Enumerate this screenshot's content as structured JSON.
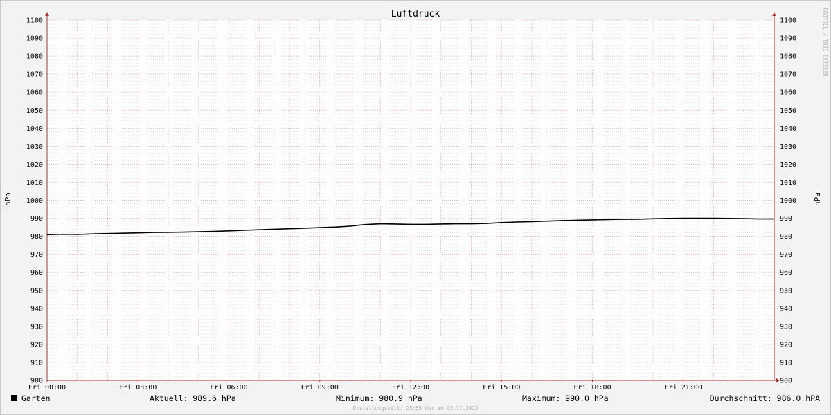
{
  "chart_data": {
    "type": "line",
    "title": "Luftdruck",
    "ylabel": "hPa",
    "ylim": [
      900,
      1100
    ],
    "y_ticks": [
      900,
      910,
      920,
      930,
      940,
      950,
      960,
      970,
      980,
      990,
      1000,
      1010,
      1020,
      1030,
      1040,
      1050,
      1060,
      1070,
      1080,
      1090,
      1100
    ],
    "x_ticks": [
      {
        "hour": 0,
        "label": "Fri 00:00"
      },
      {
        "hour": 3,
        "label": "Fri 03:00"
      },
      {
        "hour": 6,
        "label": "Fri 06:00"
      },
      {
        "hour": 9,
        "label": "Fri 09:00"
      },
      {
        "hour": 12,
        "label": "Fri 12:00"
      },
      {
        "hour": 15,
        "label": "Fri 15:00"
      },
      {
        "hour": 18,
        "label": "Fri 18:00"
      },
      {
        "hour": 21,
        "label": "Fri 21:00"
      }
    ],
    "xlim_hours": [
      0,
      24
    ],
    "grid": true,
    "series": [
      {
        "name": "Garten",
        "color": "#000000",
        "points": [
          [
            0.0,
            980.9
          ],
          [
            0.5,
            981.1
          ],
          [
            1.0,
            981.0
          ],
          [
            1.5,
            981.3
          ],
          [
            2.0,
            981.5
          ],
          [
            2.5,
            981.7
          ],
          [
            3.0,
            981.9
          ],
          [
            3.5,
            982.1
          ],
          [
            4.0,
            982.2
          ],
          [
            4.5,
            982.3
          ],
          [
            5.0,
            982.5
          ],
          [
            5.5,
            982.7
          ],
          [
            6.0,
            983.0
          ],
          [
            6.5,
            983.3
          ],
          [
            7.0,
            983.6
          ],
          [
            7.5,
            983.9
          ],
          [
            8.0,
            984.2
          ],
          [
            8.5,
            984.5
          ],
          [
            9.0,
            984.8
          ],
          [
            9.5,
            985.1
          ],
          [
            10.0,
            985.6
          ],
          [
            10.5,
            986.5
          ],
          [
            11.0,
            986.9
          ],
          [
            11.5,
            986.8
          ],
          [
            12.0,
            986.6
          ],
          [
            12.5,
            986.6
          ],
          [
            13.0,
            986.8
          ],
          [
            13.5,
            986.9
          ],
          [
            14.0,
            986.9
          ],
          [
            14.5,
            987.1
          ],
          [
            15.0,
            987.6
          ],
          [
            15.5,
            987.9
          ],
          [
            16.0,
            988.1
          ],
          [
            16.5,
            988.4
          ],
          [
            17.0,
            988.7
          ],
          [
            17.5,
            988.9
          ],
          [
            18.0,
            989.1
          ],
          [
            18.5,
            989.3
          ],
          [
            19.0,
            989.4
          ],
          [
            19.5,
            989.5
          ],
          [
            20.0,
            989.7
          ],
          [
            20.5,
            989.9
          ],
          [
            21.0,
            990.0
          ],
          [
            21.5,
            990.0
          ],
          [
            22.0,
            990.0
          ],
          [
            22.5,
            989.9
          ],
          [
            23.0,
            989.8
          ],
          [
            23.5,
            989.6
          ],
          [
            24.0,
            989.6
          ]
        ]
      }
    ],
    "legend": {
      "label": "Garten",
      "current": "Aktuell: 989.6 hPa",
      "minimum": "Minimum: 980.9 hPa",
      "maximum": "Maximum: 990.0 hPa",
      "average": "Durchschnitt: 986.0 hPA"
    },
    "created": "Erstellungszeit: 23:55 Uhr am 03.11.2023",
    "watermark": "RRDTOOL / TOBI OETIKER",
    "colors": {
      "background": "#f3f3f3",
      "plot": "#ffffff",
      "major_grid": "#e89a9a",
      "minor_grid": "#d9d9d9",
      "axis": "#b03030",
      "line": "#000000"
    }
  }
}
